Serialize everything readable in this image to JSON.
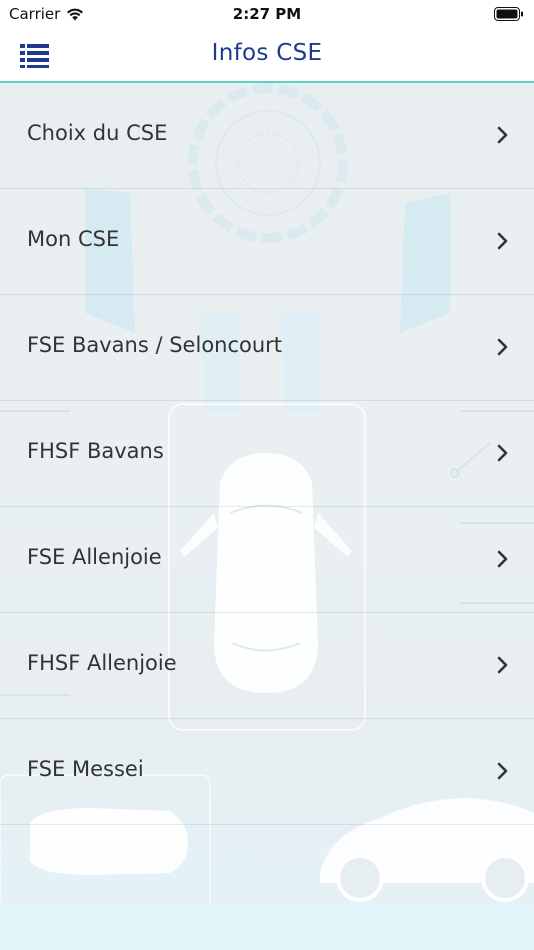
{
  "status_bar": {
    "carrier": "Carrier",
    "time": "2:27 PM"
  },
  "nav": {
    "title": "Infos CSE",
    "menu_icon": "list-icon"
  },
  "list": {
    "items": [
      {
        "label": "Choix du CSE"
      },
      {
        "label": "Mon CSE"
      },
      {
        "label": "FSE Bavans / Seloncourt"
      },
      {
        "label": "FHSF Bavans"
      },
      {
        "label": "FSE Allenjoie"
      },
      {
        "label": "FHSF Allenjoie"
      },
      {
        "label": "FSE Messei"
      }
    ]
  },
  "colors": {
    "accent": "#1f3a8f",
    "separator": "#5fd1c4",
    "text": "#333333"
  }
}
